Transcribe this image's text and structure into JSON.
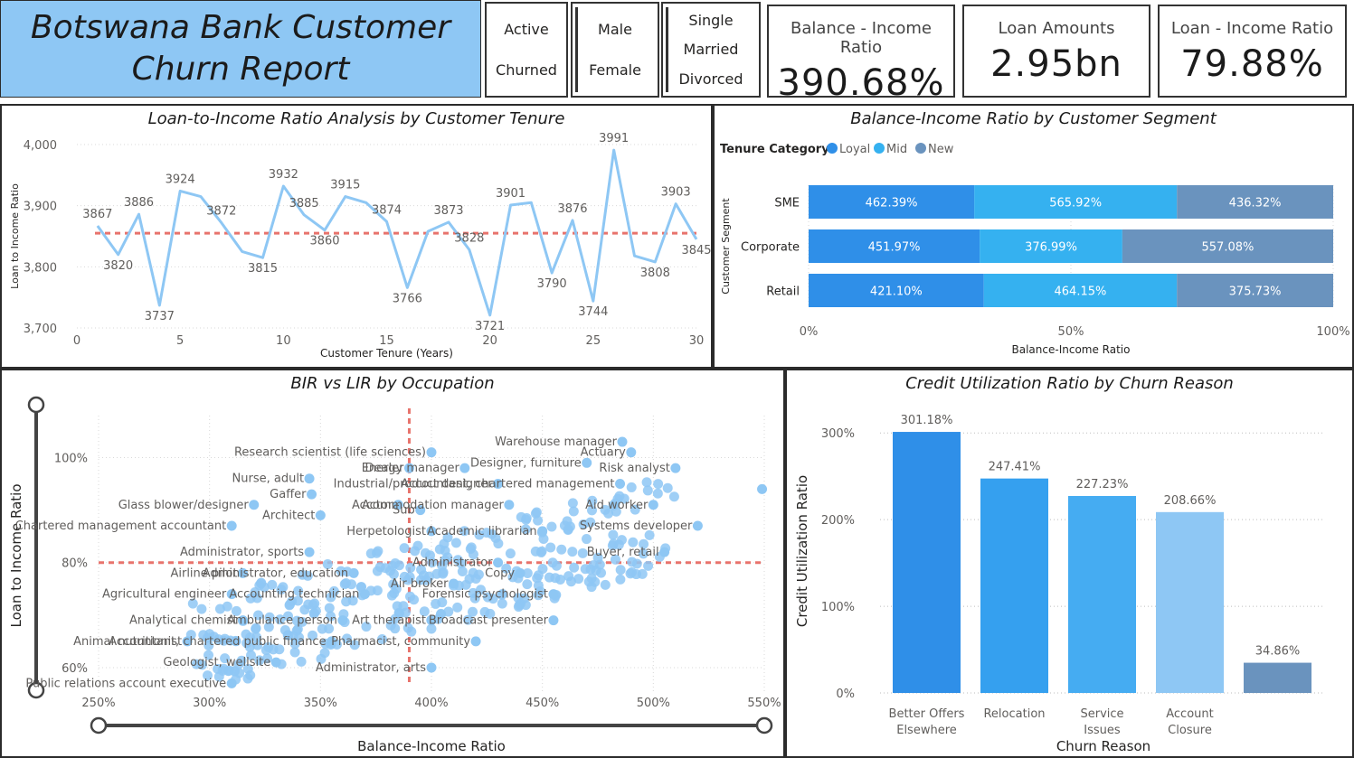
{
  "header": {
    "title": "Botswana Bank Customer\nChurn Report"
  },
  "slicers": [
    {
      "options": [
        "Active",
        "Churned"
      ]
    },
    {
      "options": [
        "Male",
        "Female"
      ]
    },
    {
      "options": [
        "Single",
        "Married",
        "Divorced"
      ]
    }
  ],
  "kpis": [
    {
      "label": "Balance - Income Ratio",
      "value": "390.68%"
    },
    {
      "label": "Loan Amounts",
      "value": "2.95bn"
    },
    {
      "label": "Loan - Income Ratio",
      "value": "79.88%"
    }
  ],
  "colors": {
    "line": "#8ec7f4",
    "ref": "#e8736c",
    "loyal": "#2f8fe8",
    "mid": "#35b1f0",
    "new": "#6a93be",
    "scatter": "#8ec7f4",
    "bars": [
      "#2f8fe8",
      "#35a0ef",
      "#45acf2",
      "#8ec7f4",
      "#6a93be"
    ]
  },
  "chart_data": [
    {
      "type": "line",
      "title": "Loan-to-Income Ratio Analysis by Customer Tenure",
      "xlabel": "Customer Tenure (Years)",
      "ylabel": "Loan to Income Ratio",
      "xlim": [
        0,
        30
      ],
      "ylim": [
        3700,
        4000
      ],
      "xticks": [
        "0",
        "5",
        "10",
        "15",
        "20",
        "25",
        "30"
      ],
      "yticks": [
        "3,700",
        "3,800",
        "3,900",
        "4,000"
      ],
      "reference_line": 3855,
      "x": [
        1,
        2,
        3,
        4,
        5,
        6,
        7,
        8,
        9,
        10,
        11,
        12,
        13,
        14,
        15,
        16,
        17,
        18,
        19,
        20,
        21,
        22,
        23,
        24,
        25,
        26,
        27,
        28,
        29,
        30
      ],
      "y": [
        3867,
        3820,
        3886,
        3737,
        3924,
        3915,
        3872,
        3825,
        3815,
        3932,
        3885,
        3860,
        3915,
        3905,
        3874,
        3766,
        3858,
        3873,
        3828,
        3721,
        3901,
        3905,
        3790,
        3876,
        3744,
        3991,
        3818,
        3808,
        3903,
        3845
      ],
      "point_labels": [
        "3867",
        "3820",
        "3886",
        "3737",
        "3924",
        "",
        "3872",
        "",
        "3815",
        "3932",
        "3885",
        "3860",
        "3915",
        "",
        "3874",
        "3766",
        "",
        "3873",
        "3828",
        "3721",
        "3901",
        "",
        "3790",
        "3876",
        "3744",
        "3991",
        "",
        "3808",
        "3903",
        "3845"
      ]
    },
    {
      "type": "bar",
      "stacked": "100%",
      "title": "Balance-Income Ratio by Customer Segment",
      "legend_title": "Tenure Category",
      "xlabel": "Balance-Income Ratio",
      "ylabel": "Customer Segment",
      "xticks": [
        "0%",
        "50%",
        "100%"
      ],
      "categories": [
        "SME",
        "Corporate",
        "Retail"
      ],
      "series": [
        {
          "name": "Loyal",
          "values": [
            462.39,
            451.97,
            421.1
          ],
          "labels": [
            "462.39%",
            "451.97%",
            "421.10%"
          ]
        },
        {
          "name": "Mid",
          "values": [
            565.92,
            376.99,
            464.15
          ],
          "labels": [
            "565.92%",
            "376.99%",
            "464.15%"
          ]
        },
        {
          "name": "New",
          "values": [
            436.32,
            557.08,
            375.73
          ],
          "labels": [
            "436.32%",
            "557.08%",
            "375.73%"
          ]
        }
      ]
    },
    {
      "type": "scatter",
      "title": "BIR vs LIR by Occupation",
      "xlabel": "Balance-Income Ratio",
      "ylabel": "Loan to Income Ratio",
      "xlim": [
        250,
        550
      ],
      "ylim": [
        55,
        108
      ],
      "xticks": [
        "250%",
        "300%",
        "350%",
        "400%",
        "450%",
        "500%",
        "550%"
      ],
      "yticks": [
        "60%",
        "80%",
        "100%"
      ],
      "reference_x": 390,
      "reference_y": 80,
      "labeled_points": [
        {
          "name": "Warehouse manager",
          "x": 486,
          "y": 103
        },
        {
          "name": "Research scientist (life sciences)",
          "x": 400,
          "y": 101
        },
        {
          "name": "Actuary",
          "x": 490,
          "y": 101
        },
        {
          "name": "Designer, furniture",
          "x": 470,
          "y": 99
        },
        {
          "name": "Dealer",
          "x": 390,
          "y": 98
        },
        {
          "name": "Energy manager",
          "x": 415,
          "y": 98
        },
        {
          "name": "Risk analyst",
          "x": 510,
          "y": 98
        },
        {
          "name": "Nurse, adult",
          "x": 345,
          "y": 96
        },
        {
          "name": "Industrial/product designer",
          "x": 430,
          "y": 95
        },
        {
          "name": "Accountant, chartered management",
          "x": 485,
          "y": 95
        },
        {
          "name": "Gaffer",
          "x": 346,
          "y": 93
        },
        {
          "name": "Glass blower/designer",
          "x": 320,
          "y": 91
        },
        {
          "name": "Aid worker",
          "x": 500,
          "y": 91
        },
        {
          "name": "Actor",
          "x": 385,
          "y": 91
        },
        {
          "name": "Sub",
          "x": 395,
          "y": 90
        },
        {
          "name": "Accommodation manager",
          "x": 435,
          "y": 91
        },
        {
          "name": "Architect",
          "x": 350,
          "y": 89
        },
        {
          "name": "Chartered management accountant",
          "x": 310,
          "y": 87
        },
        {
          "name": "Systems developer",
          "x": 520,
          "y": 87
        },
        {
          "name": "Herpetologist",
          "x": 400,
          "y": 86
        },
        {
          "name": "Academic librarian",
          "x": 450,
          "y": 86
        },
        {
          "name": "Administrator, sports",
          "x": 345,
          "y": 82
        },
        {
          "name": "Buyer, retail",
          "x": 505,
          "y": 82
        },
        {
          "name": "Administrator",
          "x": 430,
          "y": 80
        },
        {
          "name": "Airline pilot",
          "x": 315,
          "y": 78
        },
        {
          "name": "Administrator, education",
          "x": 365,
          "y": 78
        },
        {
          "name": "Copy",
          "x": 440,
          "y": 78
        },
        {
          "name": "Air broker",
          "x": 410,
          "y": 76
        },
        {
          "name": "Agricultural engineer",
          "x": 310,
          "y": 74
        },
        {
          "name": "Accounting technician",
          "x": 370,
          "y": 74
        },
        {
          "name": "Forensic psychologist",
          "x": 455,
          "y": 74
        },
        {
          "name": "Analytical chemist",
          "x": 315,
          "y": 69
        },
        {
          "name": "Ambulance person",
          "x": 360,
          "y": 69
        },
        {
          "name": "Art therapist",
          "x": 400,
          "y": 69
        },
        {
          "name": "Broadcast presenter",
          "x": 455,
          "y": 69
        },
        {
          "name": "Animal nutritionist",
          "x": 290,
          "y": 65
        },
        {
          "name": "Accountant, chartered public finance",
          "x": 355,
          "y": 65
        },
        {
          "name": "Pharmacist, community",
          "x": 420,
          "y": 65
        },
        {
          "name": "Geologist, wellsite",
          "x": 330,
          "y": 61
        },
        {
          "name": "Administrator, arts",
          "x": 400,
          "y": 60
        },
        {
          "name": "Public relations account executive",
          "x": 310,
          "y": 57
        }
      ]
    },
    {
      "type": "bar",
      "title": "Credit Utilization Ratio by Churn Reason",
      "xlabel": "Churn Reason",
      "ylabel": "Credit Utilization Ratio",
      "ylim": [
        0,
        320
      ],
      "yticks": [
        "0%",
        "100%",
        "200%",
        "300%"
      ],
      "categories": [
        "Better Offers Elsewhere",
        "Relocation",
        "Service Issues",
        "Account Closure",
        ""
      ],
      "values": [
        301.18,
        247.41,
        227.23,
        208.66,
        34.86
      ],
      "labels": [
        "301.18%",
        "247.41%",
        "227.23%",
        "208.66%",
        "34.86%"
      ]
    }
  ]
}
